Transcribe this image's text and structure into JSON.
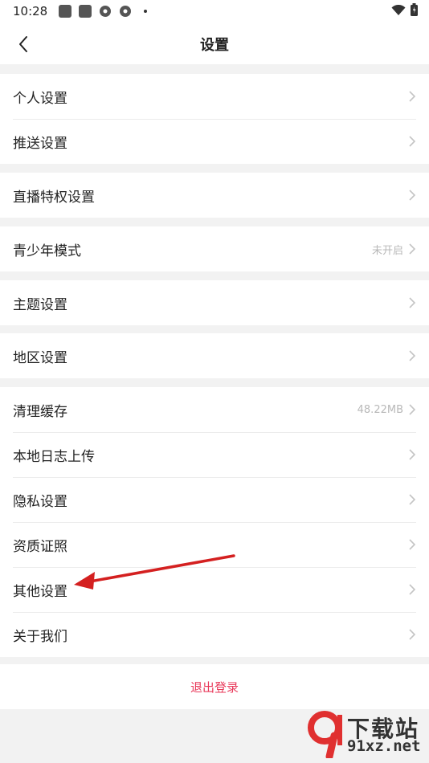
{
  "status_bar": {
    "time": "10:28"
  },
  "nav": {
    "title": "设置"
  },
  "groups": [
    {
      "items": [
        {
          "label": "个人设置",
          "value": ""
        },
        {
          "label": "推送设置",
          "value": ""
        }
      ]
    },
    {
      "items": [
        {
          "label": "直播特权设置",
          "value": ""
        }
      ]
    },
    {
      "items": [
        {
          "label": "青少年模式",
          "value": "未开启"
        }
      ]
    },
    {
      "items": [
        {
          "label": "主题设置",
          "value": ""
        }
      ]
    },
    {
      "items": [
        {
          "label": "地区设置",
          "value": ""
        }
      ]
    },
    {
      "items": [
        {
          "label": "清理缓存",
          "value": "48.22MB"
        },
        {
          "label": "本地日志上传",
          "value": ""
        },
        {
          "label": "隐私设置",
          "value": ""
        },
        {
          "label": "资质证照",
          "value": ""
        },
        {
          "label": "其他设置",
          "value": ""
        },
        {
          "label": "关于我们",
          "value": ""
        }
      ]
    }
  ],
  "logout": {
    "label": "退出登录"
  },
  "watermark": {
    "line1": "下载站",
    "line2": "91xz.net"
  },
  "colors": {
    "logout": "#e8395a",
    "arrow": "#d42020",
    "background": "#f2f2f2"
  }
}
